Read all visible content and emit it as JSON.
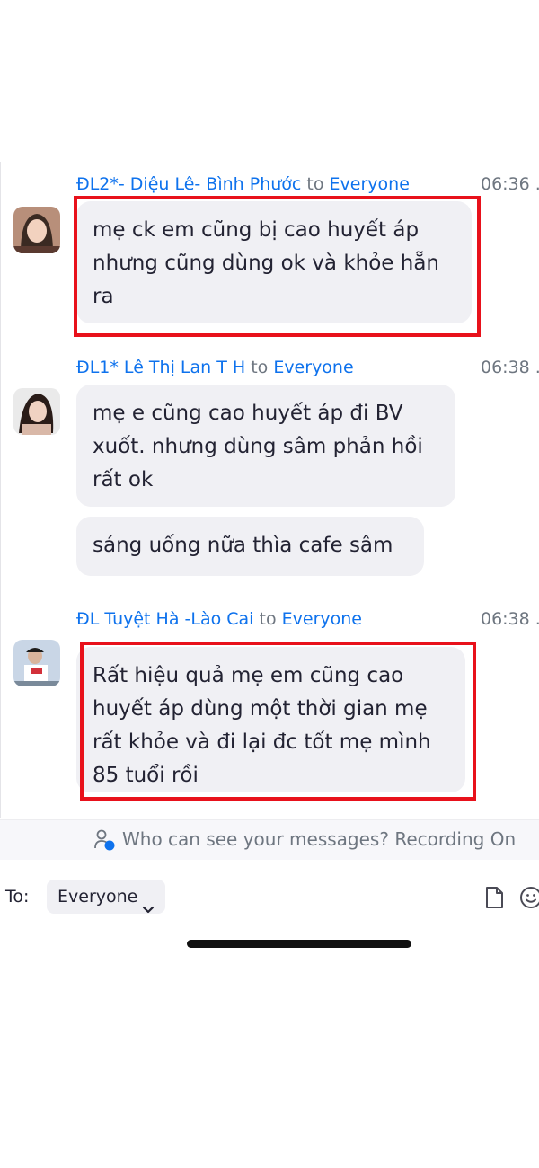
{
  "messages": [
    {
      "sender": "ĐL2*- Diệu Lê- Bình Phước",
      "to_word": "to",
      "recipient": "Everyone",
      "time": "06:36 ...",
      "bubbles": [
        "mẹ ck em cũng bị cao huyết áp nhưng cũng dùng ok và khỏe hẵn ra"
      ]
    },
    {
      "sender": "ĐL1* Lê Thị Lan T H",
      "to_word": "to",
      "recipient": "Everyone",
      "time": "06:38 ...",
      "bubbles": [
        "mẹ e cũng cao huyết áp đi BV xuốt. nhưng dùng sâm phản hồi rất ok",
        "sáng uống nữa thìa cafe sâm"
      ]
    },
    {
      "sender": "ĐL Tuyệt Hà -Lào Cai",
      "to_word": "to",
      "recipient": "Everyone",
      "time": "06:38 ...",
      "bubbles": [
        "Rất hiệu quả mẹ em cũng cao huyết áp dùng một thời gian mẹ rất khỏe và đi lại đc tốt mẹ mình 85 tuổi rồi"
      ]
    }
  ],
  "info_bar": {
    "text": "Who can see your messages? Recording On",
    "icon": "person-lock-icon"
  },
  "composer": {
    "to_label": "To:",
    "recipient": "Everyone",
    "file_icon": "file-icon",
    "emoji_icon": "emoji-icon"
  },
  "colors": {
    "link_blue": "#0e72ed",
    "highlight_red": "#e8111b",
    "bubble_bg": "#f0f0f4"
  }
}
